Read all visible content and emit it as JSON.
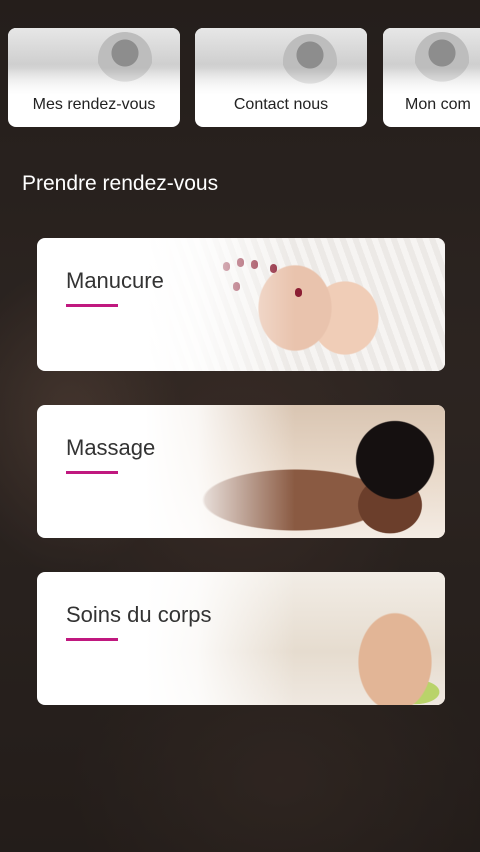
{
  "top_cards": [
    {
      "label": "Mes rendez-vous"
    },
    {
      "label": "Contact nous"
    },
    {
      "label": "Mon com"
    }
  ],
  "section_title": "Prendre rendez-vous",
  "services": [
    {
      "label": "Manucure"
    },
    {
      "label": "Massage"
    },
    {
      "label": "Soins du corps"
    }
  ],
  "colors": {
    "accent_underline": "#c0187f",
    "card_background": "#ffffff",
    "page_background": "#2b2522"
  }
}
